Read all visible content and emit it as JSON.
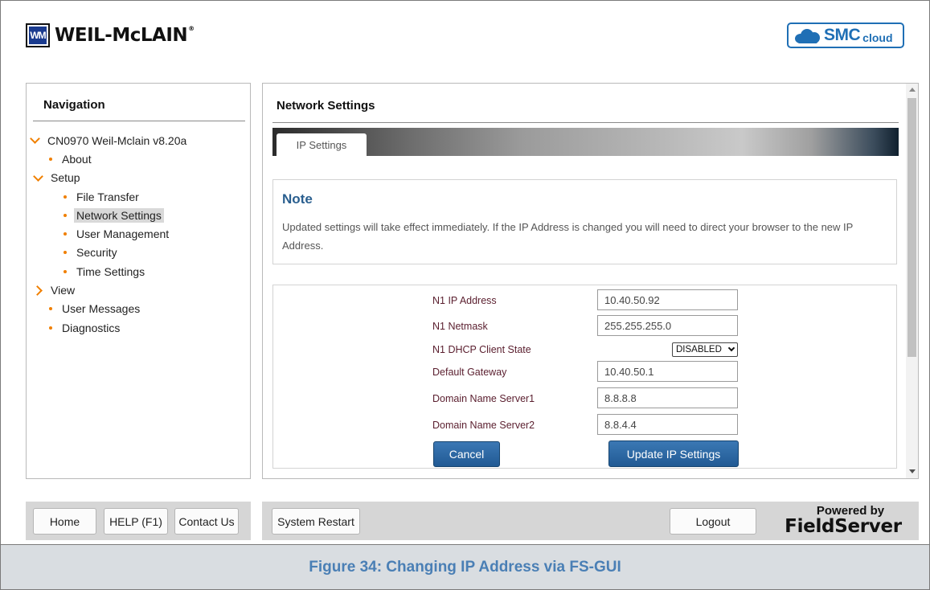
{
  "header": {
    "logo_monogram": "WM",
    "logo_text": "WEIL-McLAIN",
    "logo_reg": "®",
    "smc_text": "SMC",
    "smc_cloud_text": "cloud"
  },
  "nav": {
    "title": "Navigation",
    "items": [
      {
        "label": "CN0970 Weil-Mclain v8.20a",
        "level": 0,
        "icon": "chevron-down-icon"
      },
      {
        "label": "About",
        "level": 1,
        "icon": "bullet"
      },
      {
        "label": "Setup",
        "level": 1,
        "icon": "chevron-down-icon"
      },
      {
        "label": "File Transfer",
        "level": 2,
        "icon": "bullet"
      },
      {
        "label": "Network Settings",
        "level": 2,
        "icon": "bullet",
        "active": true
      },
      {
        "label": "User Management",
        "level": 2,
        "icon": "bullet"
      },
      {
        "label": "Security",
        "level": 2,
        "icon": "bullet"
      },
      {
        "label": "Time Settings",
        "level": 2,
        "icon": "bullet"
      },
      {
        "label": "View",
        "level": 1,
        "icon": "chevron-right-icon"
      },
      {
        "label": "User Messages",
        "level": 1,
        "icon": "bullet"
      },
      {
        "label": "Diagnostics",
        "level": 1,
        "icon": "bullet"
      }
    ]
  },
  "main": {
    "title": "Network Settings",
    "tab_label": "IP Settings",
    "note_title": "Note",
    "note_body": "Updated settings will take effect immediately. If the IP Address is changed you will need to direct your browser to the new IP Address.",
    "fields": {
      "ip_label": "N1 IP Address",
      "ip_value": "10.40.50.92",
      "netmask_label": "N1 Netmask",
      "netmask_value": "255.255.255.0",
      "dhcp_label": "N1 DHCP Client State",
      "dhcp_value": "DISABLED",
      "gateway_label": "Default Gateway",
      "gateway_value": "10.40.50.1",
      "dns1_label": "Domain Name Server1",
      "dns1_value": "8.8.8.8",
      "dns2_label": "Domain Name Server2",
      "dns2_value": "8.8.4.4"
    },
    "cancel_label": "Cancel",
    "update_label": "Update IP Settings"
  },
  "footer": {
    "home_label": "Home",
    "help_label": "HELP (F1)",
    "contact_label": "Contact Us",
    "restart_label": "System Restart",
    "logout_label": "Logout",
    "powered_by": "Powered by",
    "fieldserver": "FieldServer"
  },
  "caption": "Figure 34: Changing IP Address via FS-GUI",
  "colors": {
    "accent_orange": "#f07f00",
    "button_blue": "#2a64a0",
    "note_title_blue": "#2a5f8f",
    "caption_blue": "#4a7fb5"
  }
}
